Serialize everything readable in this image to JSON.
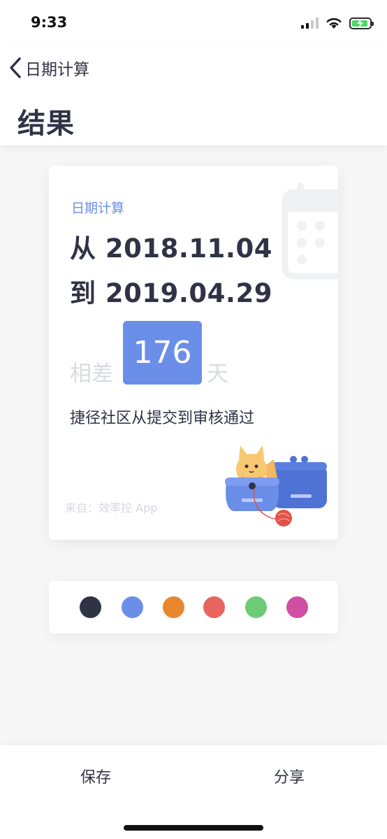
{
  "status_bar": {
    "time": "9:33",
    "icons": [
      "signal-icon",
      "wifi-icon",
      "battery-charging-icon"
    ],
    "battery_level": 0.8
  },
  "nav": {
    "back_label": "日期计算",
    "page_title": "结果"
  },
  "card": {
    "label": "日期计算",
    "from_line": "从 2018.11.04",
    "to_line": "到 2019.04.29",
    "diff_prefix": "相差",
    "diff_days": "176",
    "diff_suffix": "天",
    "event_title": "捷径社区从提交到审核通过",
    "source": "来自：效率控 App",
    "decorations": [
      "calendar-icon",
      "cat-in-purses-illustration"
    ]
  },
  "palette": {
    "swatches": [
      {
        "name": "dark",
        "color": "#2f3345"
      },
      {
        "name": "blue",
        "color": "#6b8ee8"
      },
      {
        "name": "orange",
        "color": "#e8872e"
      },
      {
        "name": "red",
        "color": "#e8645e"
      },
      {
        "name": "green",
        "color": "#6ccb74"
      },
      {
        "name": "pink",
        "color": "#d04fa3"
      }
    ],
    "selected": "blue"
  },
  "actions": {
    "save_label": "保存",
    "share_label": "分享"
  },
  "colors": {
    "accent": "#6b8ee8",
    "text_primary": "#2f3345",
    "text_faint": "#d9dbe0"
  }
}
